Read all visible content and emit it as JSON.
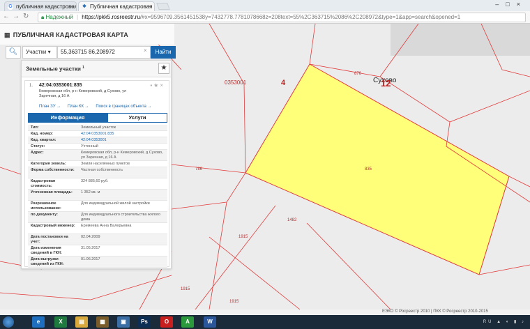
{
  "browser": {
    "tabs": [
      {
        "label": "публичная кадастровая",
        "icon": "google-icon"
      },
      {
        "label": "Публичная кадастровая",
        "icon": "rosreestr-icon"
      }
    ],
    "secure_label": "Надежный",
    "url_host": "https://pkk5.rosreestr.ru",
    "url_path": "/#x=9596709.3561451538y=7432778.7781078668z=208text=55%2C363715%2086%2C208972&type=1&app=search&opened=1"
  },
  "app": {
    "title": "ПУБЛИЧНАЯ КАДАСТРОВАЯ КАРТА"
  },
  "search": {
    "type_value": "Участки",
    "query": "55,363715 86,208972",
    "button_label": "Найти"
  },
  "panel": {
    "title": "Земельные участки",
    "count": "1",
    "item_number": "1.",
    "cadastral_id": "42:04:0353001:835",
    "address": "Кемеровская обл, р-н Кемеровский, д Сухово, ул Заречная, д 16 А",
    "links": [
      "План ЗУ →",
      "План КК →",
      "Поиск в границах объекта →"
    ],
    "tab_info": "Информация",
    "tab_services": "Услуги",
    "rows": [
      {
        "k": "Тип:",
        "v": "Земельный участок",
        "link": false
      },
      {
        "k": "Кад. номер:",
        "v": "42:04:0353001:835",
        "link": true
      },
      {
        "k": "Кад. квартал:",
        "v": "42:04:0353001",
        "link": true
      },
      {
        "k": "Статус:",
        "v": "Учтенный",
        "link": false
      },
      {
        "k": "Адрес:",
        "v": "Кемеровская обл, р-н Кемеровский, д Сухово, ул Заречная, д 16 А",
        "link": false
      },
      {
        "k": "Категория земель:",
        "v": "Земли населённых пунктов",
        "link": false
      },
      {
        "k": "Форма собственности:",
        "v": "Частная собственность",
        "link": false
      },
      {
        "k": "Кадастровая стоимость:",
        "v": "324 885,60 руб.",
        "link": false
      },
      {
        "k": "Уточненная площадь:",
        "v": "1 352 кв. м",
        "link": false
      },
      {
        "k": "Разрешенное использование:",
        "v": "Для индивидуальной жилой застройки",
        "link": false
      },
      {
        "k": "по документу:",
        "v": "Для индивидуального строительства жилого дома",
        "link": false
      },
      {
        "k": "Кадастровый инженер:",
        "v": "Еремеева Анна Валерьевна",
        "link": false
      },
      {
        "k": "Дата постановки на учет:",
        "v": "02.04.2009",
        "link": false
      },
      {
        "k": "Дата изменения сведений в ГКН:",
        "v": "31.05.2017",
        "link": false
      },
      {
        "k": "Дата выгрузки сведений из ГКН:",
        "v": "01.06.2017",
        "link": false
      }
    ]
  },
  "map": {
    "labels": {
      "quarter": "0353001",
      "num4": "4",
      "village": "Сухово",
      "num12": "12",
      "p876": "876",
      "p835": "835",
      "p786": "786",
      "p1482": "1482",
      "p1915a": "1915",
      "p1915b": "1915",
      "p1915c": "1915"
    },
    "parcel_color": "#ffff7a",
    "boundary_color": "#e23a3a"
  },
  "copyright": "ЕЭКО © Росреестр 2010 | ПКК © Росреестр 2010-2015",
  "taskbar": {
    "lang": "RU",
    "apps": [
      "ie-icon",
      "excel-icon",
      "files-icon",
      "media-icon",
      "app-icon",
      "photoshop-icon",
      "opera-icon",
      "drweb-icon",
      "word-icon"
    ]
  }
}
